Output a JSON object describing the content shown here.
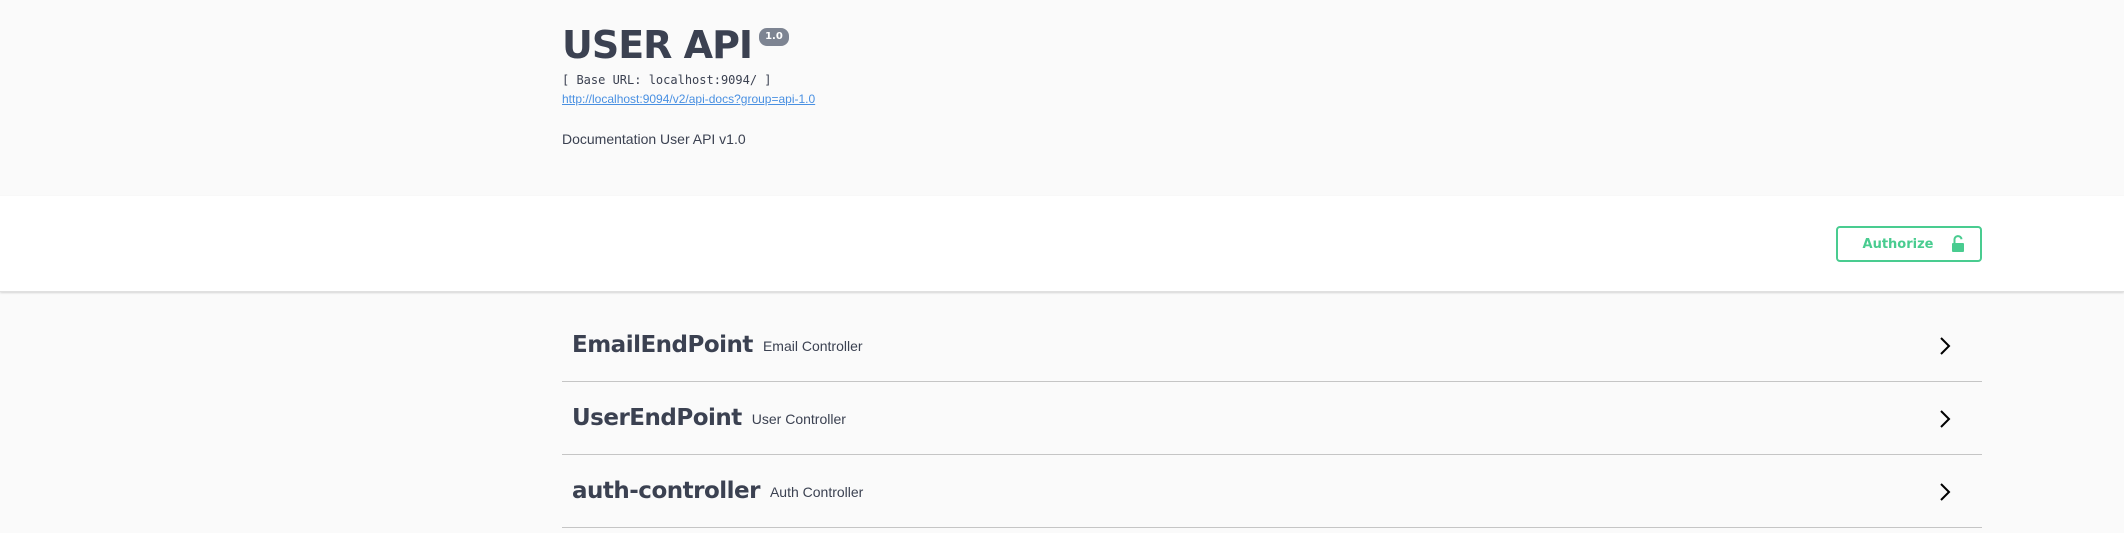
{
  "info": {
    "title": "USER API",
    "version": "1.0",
    "base_url": "[ Base URL: localhost:9094/ ]",
    "docs_link": "http://localhost:9094/v2/api-docs?group=api-1.0",
    "description": "Documentation User API v1.0"
  },
  "auth": {
    "button_label": "Authorize",
    "icon": "unlocked-lock-icon",
    "accent_color": "#49cc90"
  },
  "tags": [
    {
      "name": "EmailEndPoint",
      "description": "Email Controller"
    },
    {
      "name": "UserEndPoint",
      "description": "User Controller"
    },
    {
      "name": "auth-controller",
      "description": "Auth Controller"
    }
  ]
}
